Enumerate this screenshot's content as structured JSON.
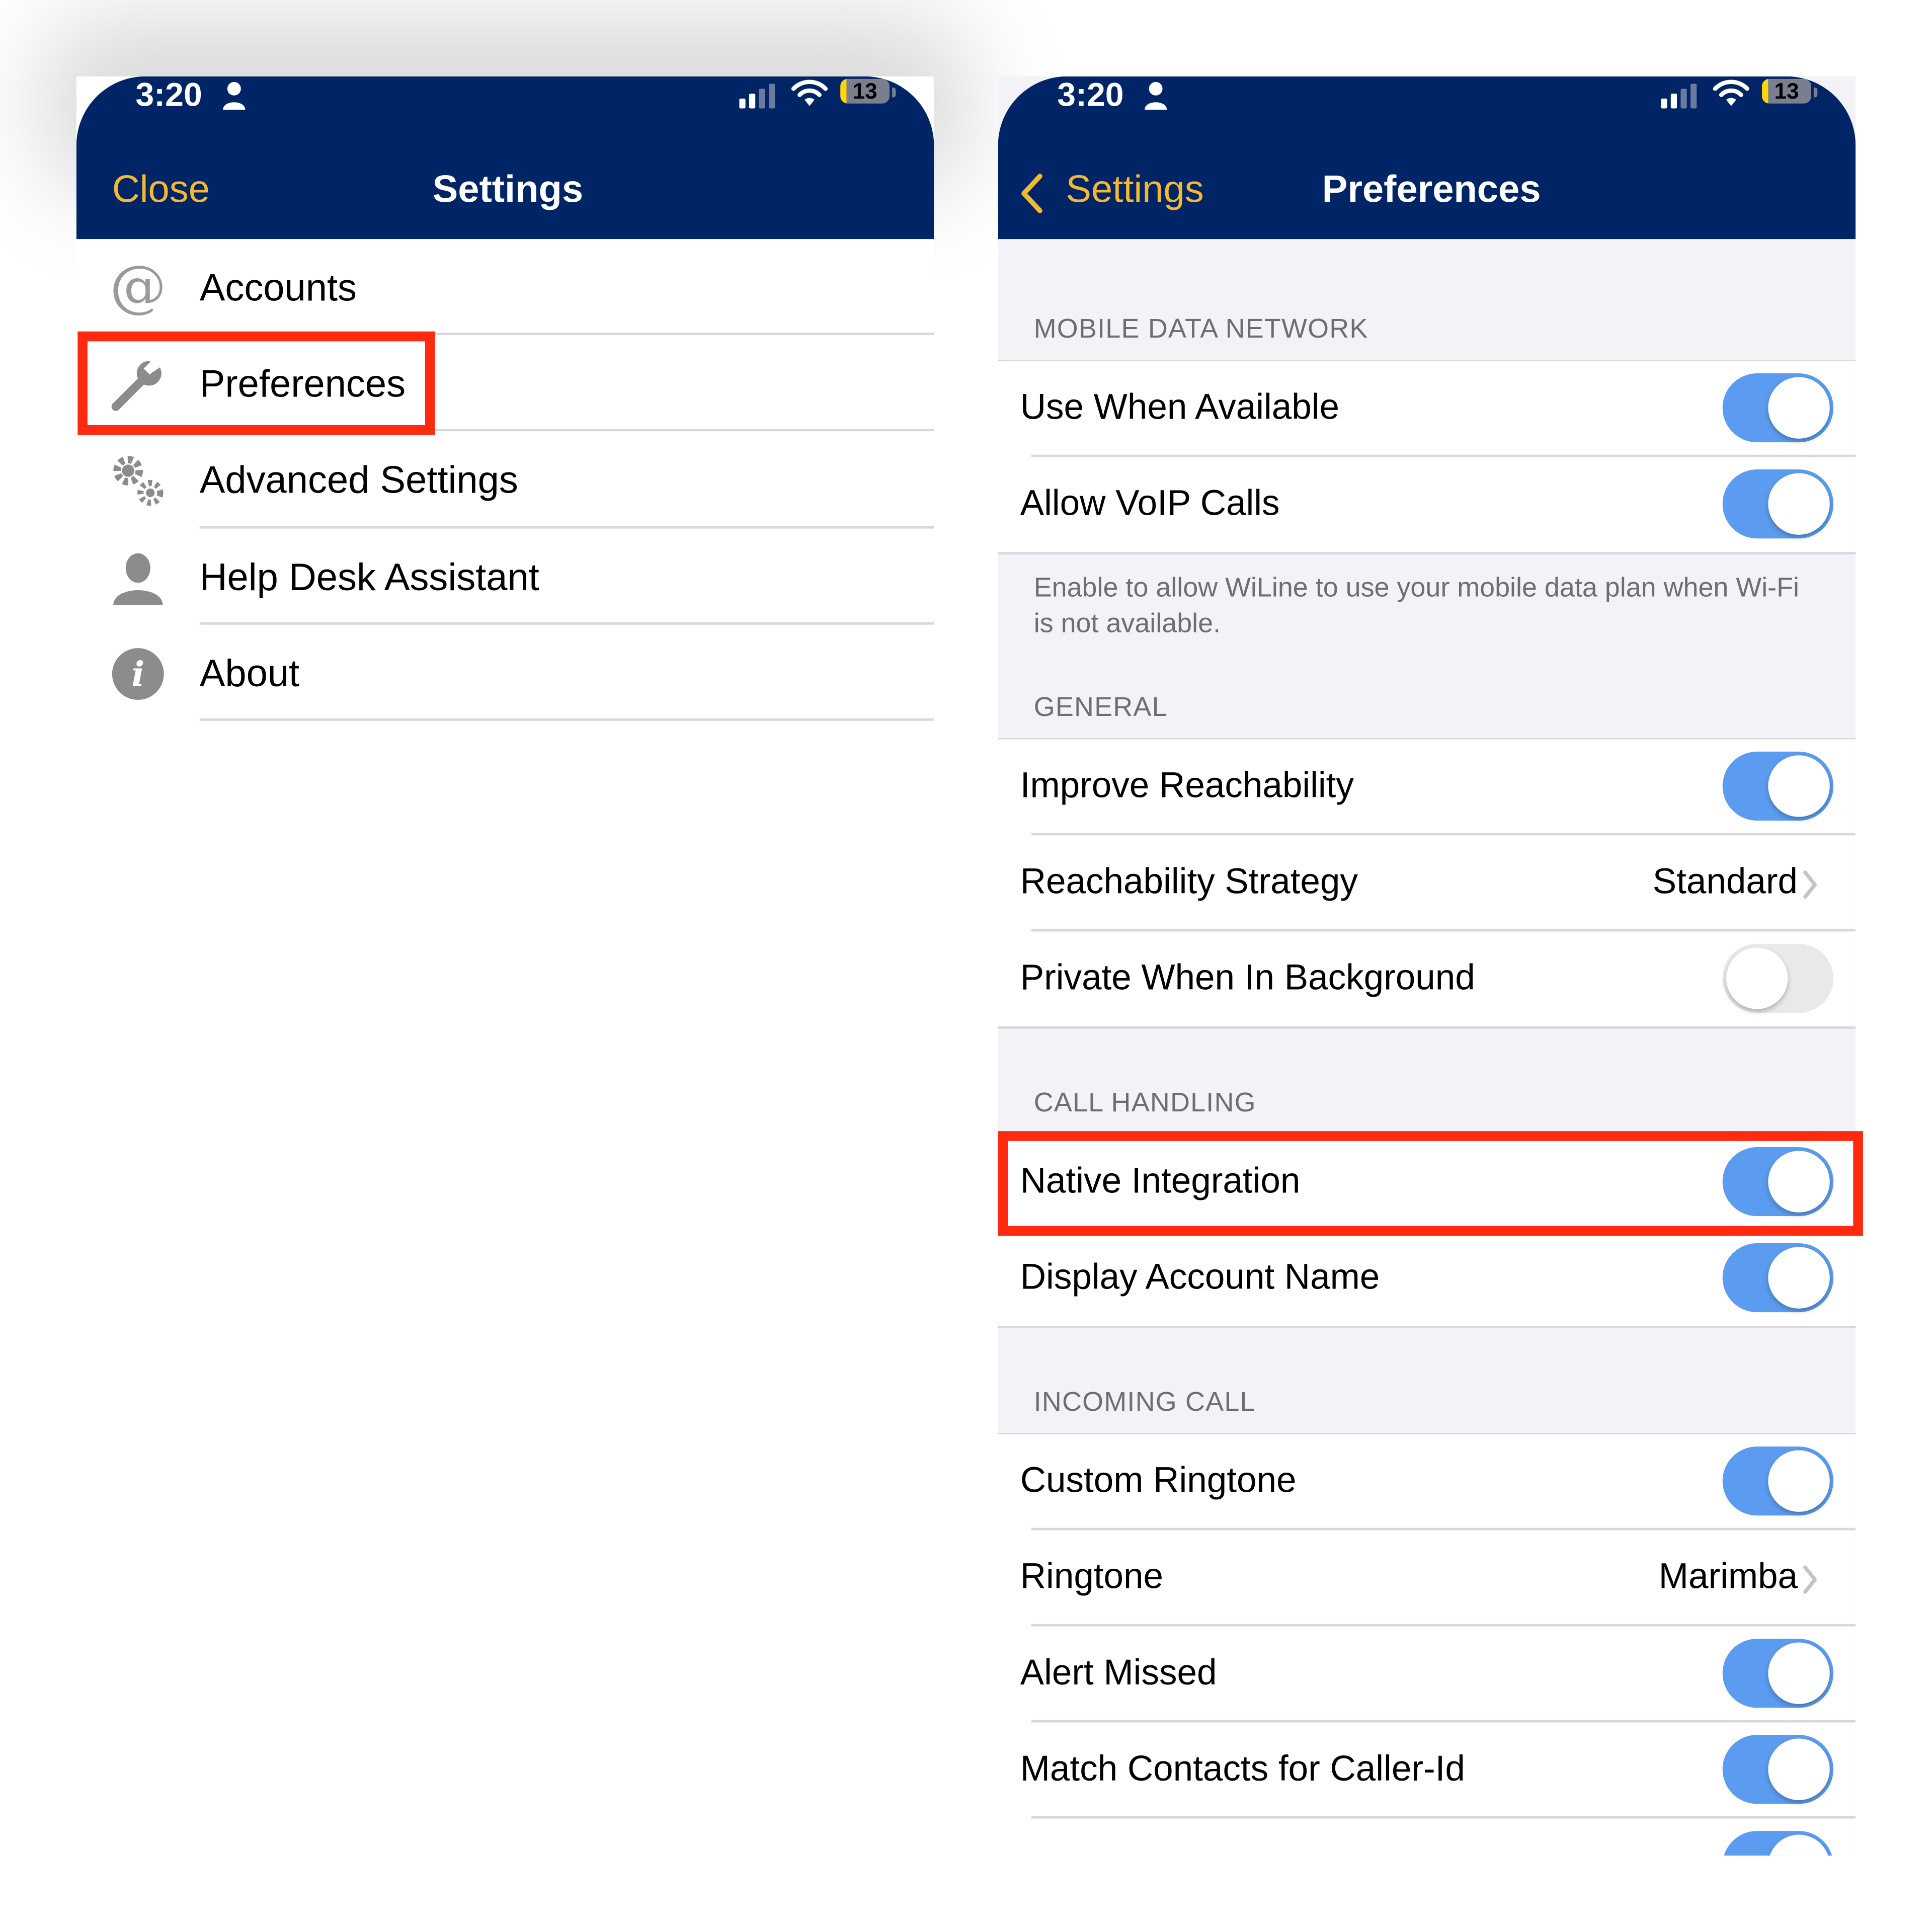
{
  "colors": {
    "nav_bar": "#002566",
    "nav_button": "#f5b82e",
    "toggle_on": "#5b9cf0",
    "highlight_box": "#ff2a10"
  },
  "left_screen": {
    "status_bar": {
      "time": "3:20",
      "battery": "13"
    },
    "nav": {
      "left_button": "Close",
      "title": "Settings"
    },
    "menu_items": [
      {
        "label": "Accounts",
        "icon": "at-sign-icon"
      },
      {
        "label": "Preferences",
        "icon": "wrench-icon"
      },
      {
        "label": "Advanced Settings",
        "icon": "gears-icon"
      },
      {
        "label": "Help Desk Assistant",
        "icon": "person-icon"
      },
      {
        "label": "About",
        "icon": "info-icon"
      }
    ]
  },
  "right_screen": {
    "status_bar": {
      "time": "3:20",
      "battery": "13"
    },
    "nav": {
      "back_button": "Settings",
      "title": "Preferences"
    },
    "sections": {
      "mobile_data": {
        "header": "MOBILE DATA NETWORK",
        "rows": [
          {
            "label": "Use When Available",
            "toggle": true
          },
          {
            "label": "Allow VoIP Calls",
            "toggle": true
          }
        ],
        "footer": "Enable to allow WiLine to use your mobile data plan when Wi-Fi is not available."
      },
      "general": {
        "header": "GENERAL",
        "rows": [
          {
            "label": "Improve Reachability",
            "toggle": true
          },
          {
            "label": "Reachability Strategy",
            "value": "Standard"
          },
          {
            "label": "Private When In Background",
            "toggle": false
          }
        ]
      },
      "call_handling": {
        "header": "CALL HANDLING",
        "rows": [
          {
            "label": "Native Integration",
            "toggle": true
          },
          {
            "label": "Display Account Name",
            "toggle": true
          }
        ]
      },
      "incoming_call": {
        "header": "INCOMING CALL",
        "rows": [
          {
            "label": "Custom Ringtone",
            "toggle": true
          },
          {
            "label": "Ringtone",
            "value": "Marimba"
          },
          {
            "label": "Alert Missed",
            "toggle": true
          },
          {
            "label": "Match Contacts for Caller-Id",
            "toggle": true
          }
        ]
      }
    }
  }
}
